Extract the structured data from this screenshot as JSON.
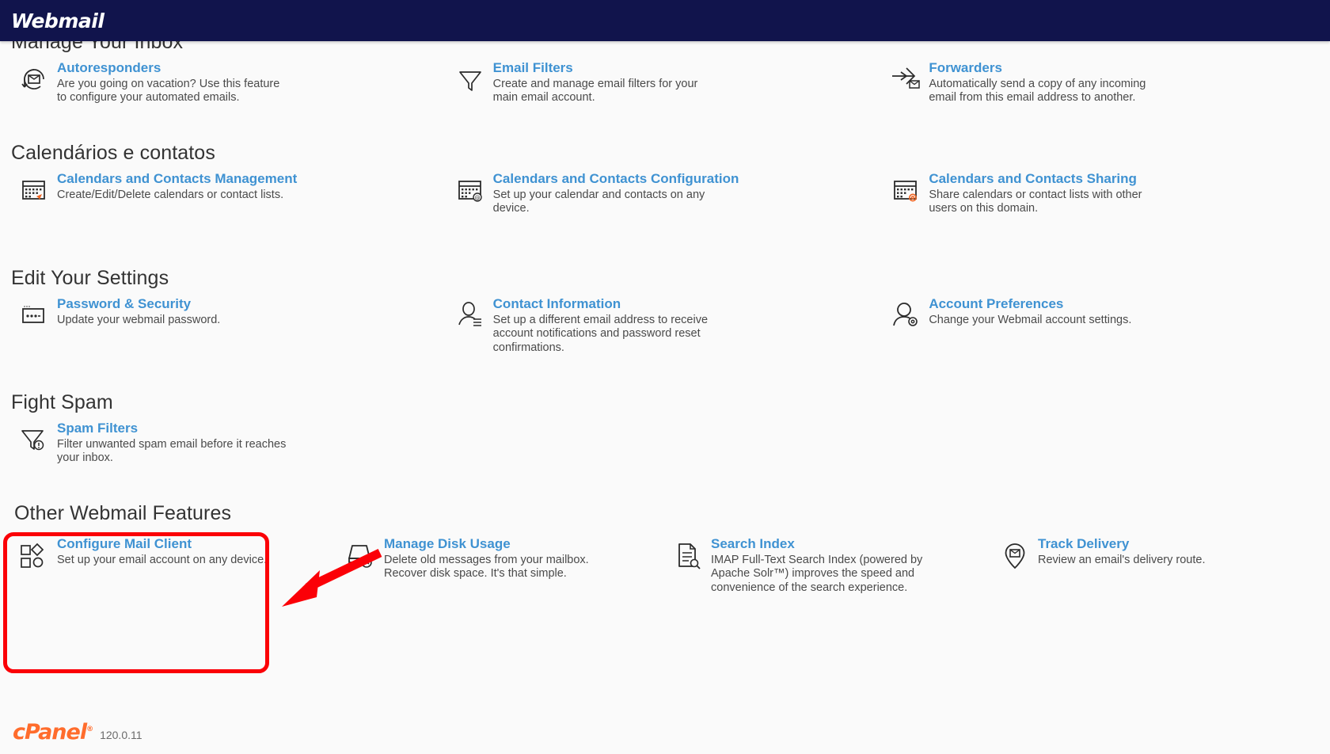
{
  "header": {
    "brand": "Webmail"
  },
  "clipped_link": "",
  "sections": [
    {
      "title": "Manage Your Inbox",
      "columns": 3,
      "items": [
        {
          "icon": "autoresponder-icon",
          "title": "Autoresponders",
          "desc": "Are you going on vacation? Use this feature to configure your automated emails."
        },
        {
          "icon": "funnel-icon",
          "title": "Email Filters",
          "desc": "Create and manage email filters for your main email account."
        },
        {
          "icon": "forward-arrow-icon",
          "title": "Forwarders",
          "desc": "Automatically send a copy of any incoming email from this email address to another."
        }
      ]
    },
    {
      "title": "Calendários e contatos",
      "columns": 3,
      "items": [
        {
          "icon": "calendar-pin-icon",
          "title": "Calendars and Contacts Management",
          "desc": "Create/Edit/Delete calendars or contact lists."
        },
        {
          "icon": "calendar-at-icon",
          "title": "Calendars and Contacts Configuration",
          "desc": "Set up your calendar and contacts on any device."
        },
        {
          "icon": "calendar-gear-icon",
          "title": "Calendars and Contacts Sharing",
          "desc": "Share calendars or contact lists with other users on this domain."
        }
      ]
    },
    {
      "title": "Edit Your Settings",
      "columns": 3,
      "items": [
        {
          "icon": "password-field-icon",
          "title": "Password & Security",
          "desc": "Update your webmail password."
        },
        {
          "icon": "contact-person-icon",
          "title": "Contact Information",
          "desc": "Set up a different email address to receive account notifications and password reset confirmations."
        },
        {
          "icon": "account-person-gear-icon",
          "title": "Account Preferences",
          "desc": "Change your Webmail account settings."
        }
      ]
    },
    {
      "title": "Fight Spam",
      "columns": 3,
      "items": [
        {
          "icon": "funnel-alert-icon",
          "title": "Spam Filters",
          "desc": "Filter unwanted spam email before it reaches your inbox."
        }
      ]
    },
    {
      "title": "Other Webmail Features",
      "columns": 4,
      "items": [
        {
          "icon": "mail-client-icon",
          "title": "Configure Mail Client",
          "desc": "Set up your email account on any device."
        },
        {
          "icon": "disk-usage-icon",
          "title": "Manage Disk Usage",
          "desc": "Delete old messages from your mailbox. Recover disk space. It's that simple."
        },
        {
          "icon": "document-search-icon",
          "title": "Search Index",
          "desc": "IMAP Full-Text Search Index (powered by Apache Solr™) improves the speed and convenience of the search experience."
        },
        {
          "icon": "map-pin-mail-icon",
          "title": "Track Delivery",
          "desc": "Review an email's delivery route."
        }
      ]
    }
  ],
  "footer": {
    "logo": "cPanel",
    "version": "120.0.11"
  },
  "colors": {
    "header_bg": "#11144c",
    "link_blue": "#3f92d2",
    "annotation_red": "#fb0007",
    "cpanel_orange": "#ff6c2c",
    "page_bg": "#fafafa"
  }
}
